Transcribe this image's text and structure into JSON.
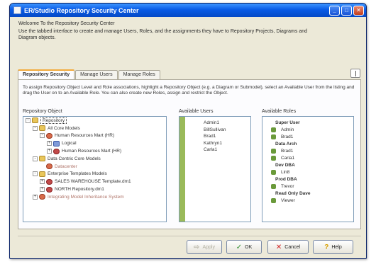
{
  "window": {
    "title": "ER/Studio Repository Security Center"
  },
  "intro": {
    "line1": "Welcome To the Repository Security Center",
    "line2": "Use the tabbed interface to create and manage Users, Roles, and the assignments they have to Repository Projects, Diagrams and Diagram objects."
  },
  "tabs": [
    {
      "label": "Repository Security"
    },
    {
      "label": "Manage Users"
    },
    {
      "label": "Manage Roles"
    }
  ],
  "panel": {
    "instructions": "To assign Repository Object Level and Role associations, highlight a Repository Object (e.g. a Diagram or Submodel), select an Available User from the listing and drag the User on to an Available Role. You can also create new Roles, assign and restrict the Object."
  },
  "columns": {
    "repository": "Repository Object",
    "users": "Available Users",
    "roles": "Available Roles"
  },
  "repository_tree": [
    {
      "label": "Repository",
      "icon": "folder-icon",
      "level": 0,
      "expander": "-",
      "selected": true
    },
    {
      "label": "All Core Models",
      "icon": "folder-icon",
      "level": 1,
      "expander": "-"
    },
    {
      "label": "Human Resources Mart (HR)",
      "icon": "model-icon",
      "level": 2,
      "expander": "-"
    },
    {
      "label": "Logical",
      "icon": "diagram-icon",
      "level": 3,
      "expander": "+"
    },
    {
      "label": "Human Resources Mart (HR)",
      "icon": "submodel-icon",
      "level": 3,
      "expander": "+"
    },
    {
      "label": "Data Centric Core Models",
      "icon": "folder-icon",
      "level": 1,
      "expander": "-"
    },
    {
      "label": "Datacenter",
      "icon": "model-icon",
      "level": 2,
      "expander": "",
      "muted": true
    },
    {
      "label": "Enterprise Templates Models",
      "icon": "folder-icon",
      "level": 1,
      "expander": "-"
    },
    {
      "label": "SALES WAREHOUSE Template.dm1",
      "icon": "submodel-icon",
      "level": 2,
      "expander": "+"
    },
    {
      "label": "NORTH Repository.dm1",
      "icon": "submodel-icon",
      "level": 2,
      "expander": "+"
    },
    {
      "label": "Integrating Model Inheritance System",
      "icon": "model-icon",
      "level": 1,
      "expander": "+",
      "muted": true
    }
  ],
  "users": [
    {
      "label": "Admin1"
    },
    {
      "label": "BillSullivan"
    },
    {
      "label": "Brad1"
    },
    {
      "label": "Kathryn1"
    },
    {
      "label": "Carla1"
    }
  ],
  "roles": [
    {
      "label": "Super User",
      "kind": "group"
    },
    {
      "label": "Admin",
      "kind": "item"
    },
    {
      "label": "Brad1",
      "kind": "item"
    },
    {
      "label": "Data Arch",
      "kind": "group"
    },
    {
      "label": "Brad1",
      "kind": "item"
    },
    {
      "label": "Carla1",
      "kind": "item"
    },
    {
      "label": "Dev DBA",
      "kind": "group"
    },
    {
      "label": "Lin8",
      "kind": "item"
    },
    {
      "label": "Prod DBA",
      "kind": "group"
    },
    {
      "label": "Trevor",
      "kind": "item"
    },
    {
      "label": "Read Only Dave",
      "kind": "group"
    },
    {
      "label": "Viewer",
      "kind": "item"
    }
  ],
  "buttons": {
    "apply": "Apply",
    "ok": "OK",
    "cancel": "Cancel",
    "help": "Help"
  }
}
